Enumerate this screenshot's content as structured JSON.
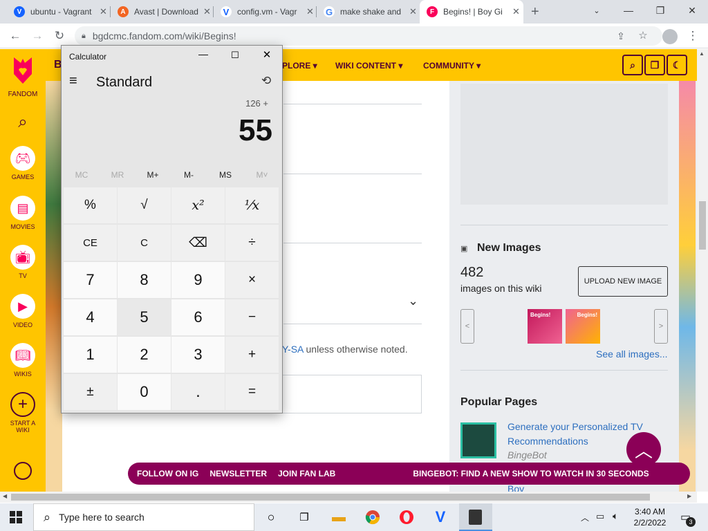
{
  "browser": {
    "tabs": [
      {
        "title": "ubuntu - Vagrant",
        "icon": "V"
      },
      {
        "title": "Avast | Download",
        "icon": "A"
      },
      {
        "title": "config.vm - Vagr",
        "icon": "V"
      },
      {
        "title": "make shake and",
        "icon": "G"
      },
      {
        "title": "Begins! | Boy Gi",
        "icon": "F"
      }
    ],
    "new_tab": "+",
    "url": "bgdcmc.fandom.com/wiki/Begins!"
  },
  "fandom": {
    "brand": "FANDOM",
    "nav": [
      {
        "label": "GAMES"
      },
      {
        "label": "MOVIES"
      },
      {
        "label": "TV"
      },
      {
        "label": "VIDEO"
      },
      {
        "label": "WIKIS"
      },
      {
        "label": "START A WIKI"
      }
    ],
    "header_letter": "B",
    "menus": [
      "PLORE ▾",
      "WIKI CONTENT ▾",
      "COMMUNITY ▾"
    ],
    "license_link": "Y-SA",
    "license_text": " unless otherwise noted.",
    "new_images": {
      "title": "New Images",
      "count": "482",
      "caption": "images on this wiki",
      "upload": "UPLOAD NEW IMAGE",
      "prev": "<",
      "next": ">",
      "see_all": "See all images...",
      "thumb_text": "Begins!"
    },
    "popular": {
      "title": "Popular Pages",
      "item_title": "Generate your Personalized TV Recommendations",
      "item_source": "BingeBot",
      "next_item": "Boy"
    },
    "footer": [
      "FOLLOW ON IG",
      "NEWSLETTER",
      "JOIN FAN LAB",
      "BINGEBOT: FIND A NEW SHOW TO WATCH IN 30 SECONDS"
    ]
  },
  "calculator": {
    "title": "Calculator",
    "mode": "Standard",
    "expression": "126 +",
    "display": "55",
    "memory": [
      "MC",
      "MR",
      "M+",
      "M-",
      "MS",
      "M˅"
    ],
    "keys": [
      "%",
      "√",
      "x²",
      "¹⁄x",
      "CE",
      "C",
      "⌫",
      "÷",
      "7",
      "8",
      "9",
      "×",
      "4",
      "5",
      "6",
      "−",
      "1",
      "2",
      "3",
      "+",
      "±",
      "0",
      ".",
      "="
    ]
  },
  "taskbar": {
    "search_placeholder": "Type here to search",
    "time": "3:40 AM",
    "date": "2/2/2022",
    "notifications": "3"
  }
}
